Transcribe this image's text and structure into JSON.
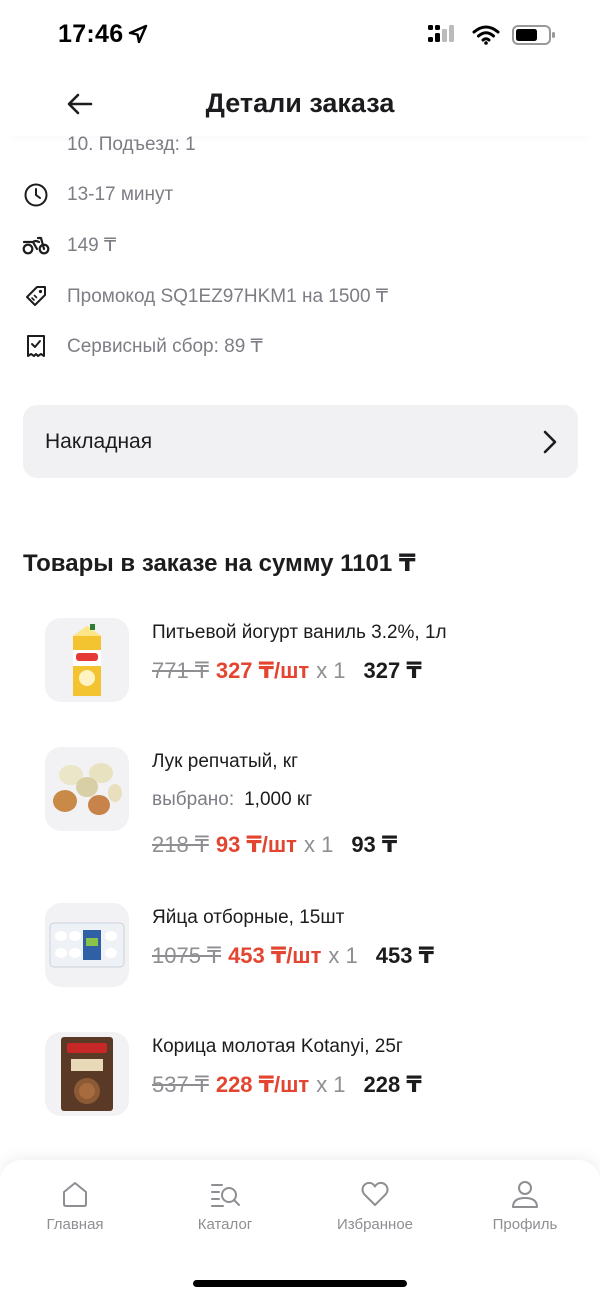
{
  "status_bar": {
    "time": "17:46"
  },
  "header": {
    "title": "Детали заказа"
  },
  "order_info": {
    "address_tail": "10. Подъезд: 1",
    "delivery_time": "13-17 минут",
    "delivery_fee": "149 ₸",
    "promo": "Промокод SQ1EZ97HKM1 на 1500 ₸",
    "service_fee": "Сервисный сбор: 89 ₸"
  },
  "invoice": {
    "label": "Накладная"
  },
  "products_section": {
    "title": "Товары в заказе на сумму 1101 ₸"
  },
  "products": [
    {
      "name": "Питьевой йогурт ваниль 3.2%, 1л",
      "old_price": "771 ₸",
      "unit_price": "327 ₸/шт",
      "qty": "x 1",
      "total": "327 ₸"
    },
    {
      "name": "Лук репчатый, кг",
      "selected_label": "выбрано:",
      "selected_value": "1,000 кг",
      "old_price": "218 ₸",
      "unit_price": "93 ₸/шт",
      "qty": "x 1",
      "total": "93 ₸"
    },
    {
      "name": "Яйца отборные, 15шт",
      "old_price": "1075 ₸",
      "unit_price": "453 ₸/шт",
      "qty": "x 1",
      "total": "453 ₸"
    },
    {
      "name": "Корица молотая Kotanyi, 25г",
      "old_price": "537 ₸",
      "unit_price": "228 ₸/шт",
      "qty": "x 1",
      "total": "228 ₸"
    }
  ],
  "tabbar": {
    "items": [
      {
        "label": "Главная",
        "icon": "home-icon"
      },
      {
        "label": "Каталог",
        "icon": "catalog-search-icon"
      },
      {
        "label": "Избранное",
        "icon": "heart-icon"
      },
      {
        "label": "Профиль",
        "icon": "profile-icon"
      }
    ]
  },
  "colors": {
    "accent_red": "#e34531",
    "muted": "#7d7d85",
    "card_bg": "#f1f1f3"
  }
}
